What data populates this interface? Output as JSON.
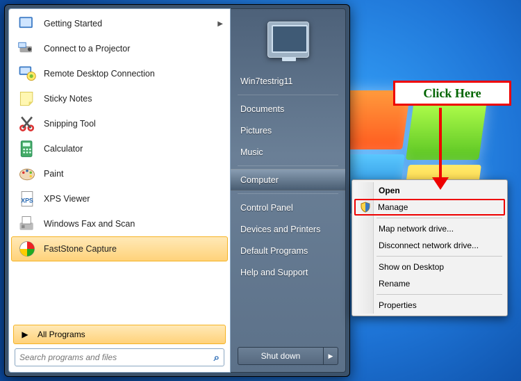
{
  "desktop": {
    "os": "Windows 7"
  },
  "callout": {
    "text": "Click Here"
  },
  "start_menu": {
    "programs": [
      {
        "label": "Getting Started",
        "icon": "getting-started-icon",
        "has_submenu": true
      },
      {
        "label": "Connect to a Projector",
        "icon": "projector-icon"
      },
      {
        "label": "Remote Desktop Connection",
        "icon": "remote-desktop-icon"
      },
      {
        "label": "Sticky Notes",
        "icon": "sticky-notes-icon"
      },
      {
        "label": "Snipping Tool",
        "icon": "snipping-tool-icon"
      },
      {
        "label": "Calculator",
        "icon": "calculator-icon"
      },
      {
        "label": "Paint",
        "icon": "paint-icon"
      },
      {
        "label": "XPS Viewer",
        "icon": "xps-viewer-icon"
      },
      {
        "label": "Windows Fax and Scan",
        "icon": "fax-scan-icon"
      },
      {
        "label": "FastStone Capture",
        "icon": "faststone-icon",
        "highlighted": true
      }
    ],
    "all_programs_label": "All Programs",
    "search_placeholder": "Search programs and files"
  },
  "right_pane": {
    "username": "Win7testrig11",
    "items_top": [
      "Documents",
      "Pictures",
      "Music"
    ],
    "computer_label": "Computer",
    "items_mid": [
      "Control Panel",
      "Devices and Printers",
      "Default Programs",
      "Help and Support"
    ],
    "shutdown_label": "Shut down"
  },
  "context_menu": {
    "items": [
      {
        "label": "Open",
        "bold": true
      },
      {
        "label": "Manage",
        "shield": true,
        "highlighted": true
      },
      "sep",
      {
        "label": "Map network drive..."
      },
      {
        "label": "Disconnect network drive..."
      },
      "sep",
      {
        "label": "Show on Desktop"
      },
      {
        "label": "Rename"
      },
      "sep",
      {
        "label": "Properties"
      }
    ]
  }
}
